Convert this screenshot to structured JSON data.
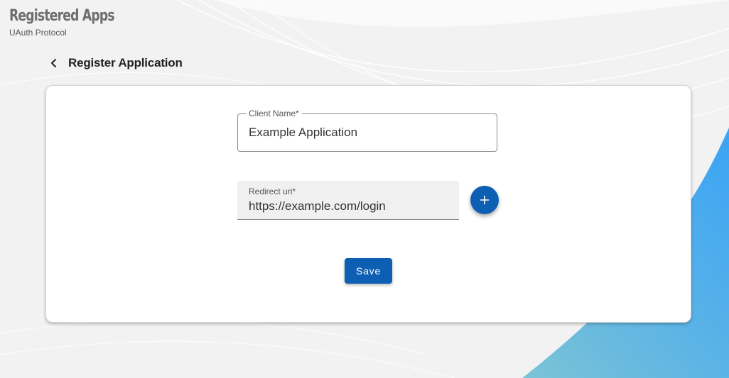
{
  "header": {
    "title": "Registered Apps",
    "subtitle": "UAuth Protocol"
  },
  "page": {
    "back_icon": "chevron-left-icon",
    "heading": "Register Application"
  },
  "form": {
    "client_name": {
      "label": "Client Name*",
      "value": "Example Application"
    },
    "redirect_uri": {
      "label": "Redirect uri*",
      "value": "https://example.com/login"
    },
    "add_icon": "plus-icon",
    "save_label": "Save"
  },
  "colors": {
    "primary": "#0d5fb3",
    "accent_gradient_start": "#6bbcd8",
    "accent_gradient_end": "#3aa3f5"
  }
}
